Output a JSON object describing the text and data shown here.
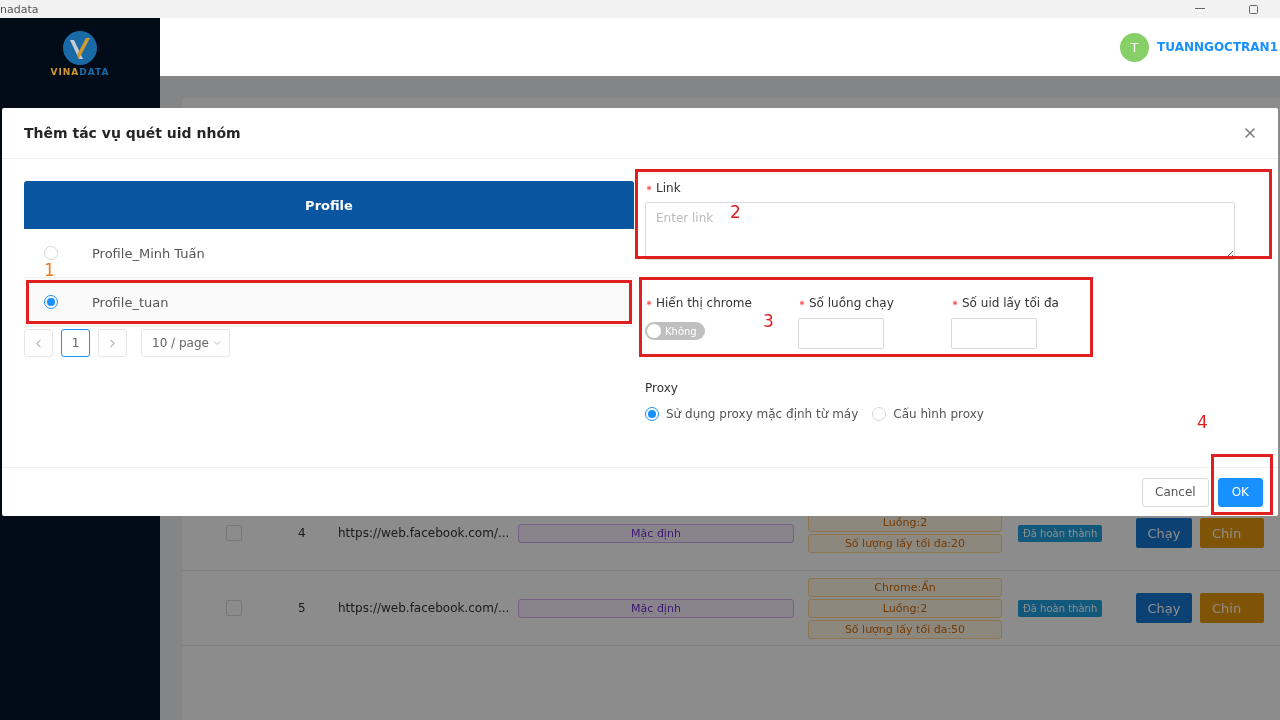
{
  "title_bar": {
    "title": "nadata"
  },
  "sidebar": {
    "logo": [
      "VINA",
      "DATA"
    ]
  },
  "header": {
    "avatar": "T",
    "user": "TUANNGOCTRAN1"
  },
  "background_rows": [
    {
      "checked": false,
      "index": "4",
      "link": "https://web.facebook.com/...",
      "type": "Mặc định",
      "tags": [
        "Luồng:2",
        "Số lượng lấy tối đa:20"
      ],
      "status": "Đã hoàn thành",
      "run": "Chạy",
      "edit": "Chỉn"
    },
    {
      "checked": false,
      "index": "5",
      "link": "https://web.facebook.com/...",
      "type": "Mặc định",
      "tags": [
        "Chrome:Ẩn",
        "Luồng:2",
        "Số lượng lấy tối đa:50"
      ],
      "status": "Đã hoàn thành",
      "run": "Chạy",
      "edit": "Chỉn"
    }
  ],
  "modal": {
    "title": "Thêm tác vụ quét uid nhóm",
    "profile_table": {
      "column": "Profile",
      "rows": [
        {
          "name": "Profile_Minh Tuấn",
          "selected": false
        },
        {
          "name": "Profile_tuan",
          "selected": true
        }
      ]
    },
    "pagination": {
      "page": "1",
      "page_size": "10 / page"
    },
    "link": {
      "label": "Link",
      "required": true,
      "placeholder": "Enter link"
    },
    "fields": [
      {
        "kind": "switch",
        "label": "Hiển thị chrome",
        "required": true,
        "on": false,
        "text": "Không"
      },
      {
        "kind": "input",
        "label": "Số luồng chạy",
        "required": true
      },
      {
        "kind": "input",
        "label": "Số uid lấy tối đa",
        "required": true
      }
    ],
    "proxy": {
      "label": "Proxy",
      "options": [
        {
          "label": "Sử dụng proxy mặc định từ máy",
          "selected": true
        },
        {
          "label": "Cấu hình proxy",
          "selected": false
        }
      ]
    },
    "buttons": {
      "cancel": "Cancel",
      "ok": "OK"
    }
  },
  "annotations": [
    {
      "number": "1",
      "color": "#f07a1a"
    },
    {
      "number": "2",
      "color": "#e02020"
    },
    {
      "number": "3",
      "color": "#e02020"
    },
    {
      "number": "4",
      "color": "#e02020"
    }
  ]
}
